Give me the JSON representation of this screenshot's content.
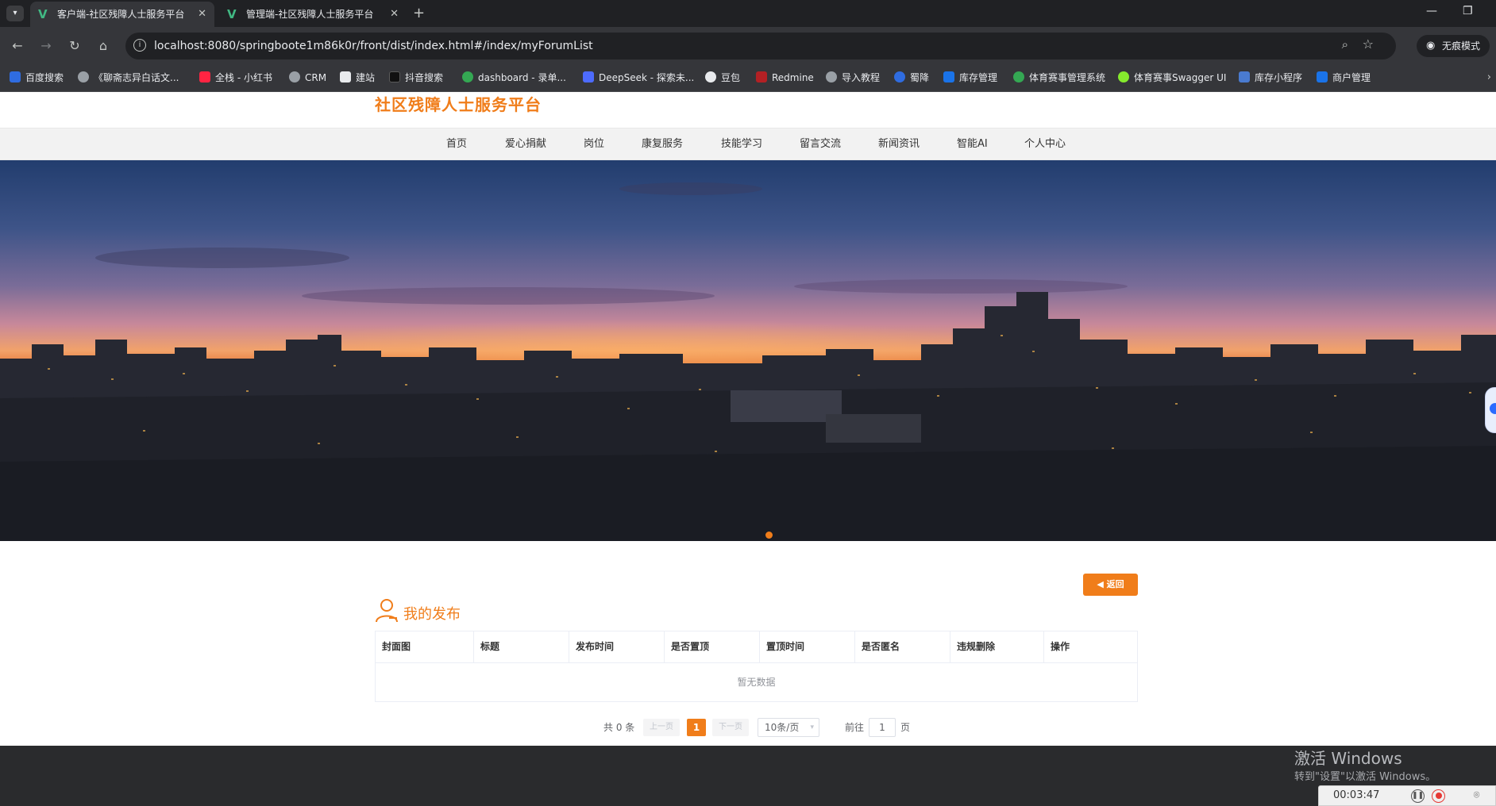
{
  "browser": {
    "tabs": [
      {
        "title": "客户端-社区残障人士服务平台",
        "active": true
      },
      {
        "title": "管理端-社区残障人士服务平台",
        "active": false
      }
    ],
    "new_tab": "+",
    "url": "localhost:8080/springboote1m86k0r/front/dist/index.html#/index/myForumList",
    "incognito_label": "无痕模式",
    "bookmarks": [
      {
        "label": "百度搜索",
        "color": "#2f6ce0"
      },
      {
        "label": "《聊斋志异白话文...",
        "color": "#9aa0a6"
      },
      {
        "label": "全栈 - 小红书",
        "color": "#ff2442"
      },
      {
        "label": "CRM",
        "color": "#9aa0a6"
      },
      {
        "label": "建站",
        "color": "#e8eaed"
      },
      {
        "label": "抖音搜索",
        "color": "#111111"
      },
      {
        "label": "dashboard - 录单...",
        "color": "#34a853"
      },
      {
        "label": "DeepSeek - 探索未...",
        "color": "#4d6bfe"
      },
      {
        "label": "豆包",
        "color": "#e8eaed"
      },
      {
        "label": "Redmine",
        "color": "#b32024"
      },
      {
        "label": "导入教程",
        "color": "#9aa0a6"
      },
      {
        "label": "蜀降",
        "color": "#2f6ce0"
      },
      {
        "label": "库存管理",
        "color": "#1a73e8"
      },
      {
        "label": "体育赛事管理系统",
        "color": "#34a853"
      },
      {
        "label": "体育赛事Swagger UI",
        "color": "#85ea2d"
      },
      {
        "label": "库存小程序",
        "color": "#4a7bd0"
      },
      {
        "label": "商户管理",
        "color": "#1a73e8"
      }
    ]
  },
  "site": {
    "title": "社区残障人士服务平台",
    "accent": "#f07d1a",
    "nav": [
      "首页",
      "爱心捐献",
      "岗位",
      "康复服务",
      "技能学习",
      "留言交流",
      "新闻资讯",
      "智能AI",
      "个人中心"
    ]
  },
  "content": {
    "back_label": "返回",
    "section_title": "我的发布",
    "table": {
      "columns": [
        "封面图",
        "标题",
        "发布时间",
        "是否置顶",
        "置顶时间",
        "是否匿名",
        "违规删除",
        "操作"
      ],
      "rows": [],
      "empty_text": "暂无数据"
    },
    "pagination": {
      "total_text": "共 0 条",
      "prev": "上一页",
      "current": "1",
      "next": "下一页",
      "page_size": "10条/页",
      "goto_prefix": "前往",
      "goto_value": "1",
      "goto_suffix": "页"
    }
  },
  "overlay": {
    "watermark_title": "激活 Windows",
    "watermark_sub": "转到\"设置\"以激活 Windows。",
    "recorder_time": "00:03:47"
  }
}
